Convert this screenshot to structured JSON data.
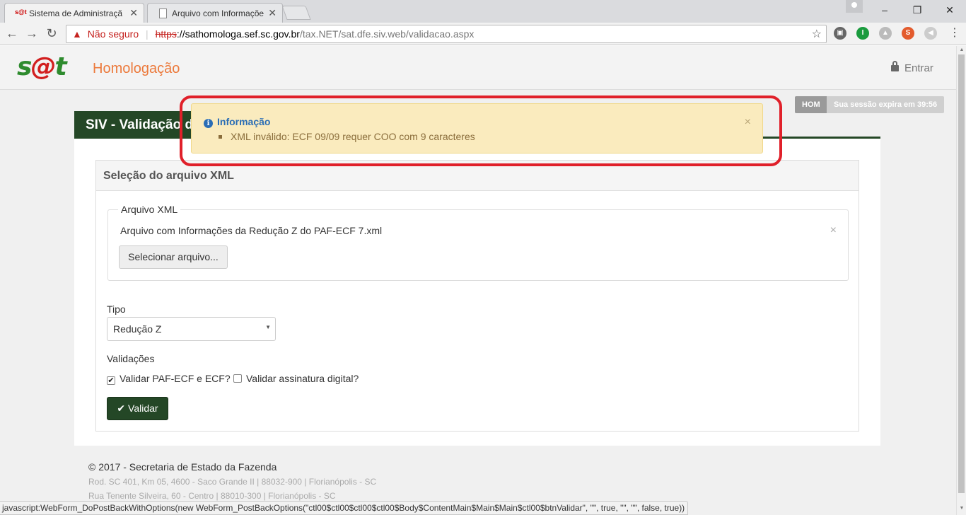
{
  "browser": {
    "tabs": [
      {
        "title": "Sistema de Administraçã",
        "favicon": "s@t"
      },
      {
        "title": "Arquivo com Informaçõe",
        "favicon": ""
      }
    ],
    "tab_close": "✕",
    "window_controls": {
      "minimize": "–",
      "restore": "❐",
      "close": "✕"
    },
    "omnibox": {
      "security_label": "Não seguro",
      "url_scheme": "https",
      "url_host": "://sathomologa.sef.sc.gov.br",
      "url_path": "/tax.NET/sat.dfe.siv.web/validacao.aspx"
    },
    "status_bar": "javascript:WebForm_DoPostBackWithOptions(new WebForm_PostBackOptions(\"ctl00$ctl00$ctl00$ctl00$Body$ContentMain$Main$Main$ctl00$btnValidar\", \"\", true, \"\", \"\", false, true))"
  },
  "header": {
    "logo_s": "s",
    "logo_at": "@",
    "logo_t": "t",
    "environment": "Homologação",
    "login_label": "Entrar",
    "env_badge": "HOM",
    "session_text": "Sua sessão expira em 39:56"
  },
  "main": {
    "page_title": "SIV - Validação de",
    "panel_title": "Seleção do arquivo XML",
    "file_legend": "Arquivo XML",
    "file_name": "Arquivo com Informações da Redução Z do PAF-ECF 7.xml",
    "file_remove": "×",
    "select_file_button": "Selecionar arquivo...",
    "tipo_label": "Tipo",
    "tipo_value": "Redução Z",
    "validacoes_label": "Validações",
    "check_paf": {
      "label": "Validar PAF-ECF e ECF?",
      "checked": true
    },
    "check_assinatura": {
      "label": "Validar assinatura digital?",
      "checked": false
    },
    "validar_button": "Validar"
  },
  "alert": {
    "title": "Informação",
    "message": "XML inválido: ECF 09/09 requer COO com 9 caracteres",
    "close": "×"
  },
  "footer": {
    "copyright": "© 2017 - Secretaria de Estado da Fazenda",
    "address1": "Rod. SC 401, Km 05, 4600 - Saco Grande II | 88032-900 | Florianópolis - SC",
    "address2": "Rua Tenente Silveira, 60 - Centro | 88010-300 | Florianópolis - SC"
  },
  "colors": {
    "brand_green": "#244726",
    "env_orange": "#ec7a3c",
    "alert_bg": "#faebbe",
    "alert_title": "#2a6db5",
    "highlight_red": "#e0202a"
  }
}
